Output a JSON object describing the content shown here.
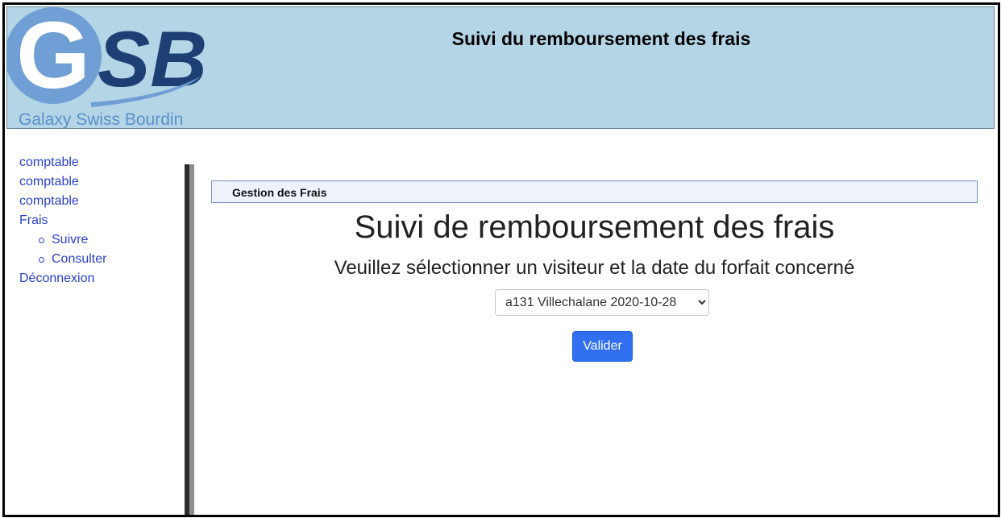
{
  "header": {
    "title": "Suivi du remboursement des frais",
    "logo": {
      "letters_g": "G",
      "letters_sb": "SB",
      "tagline": "Galaxy Swiss Bourdin",
      "colors": {
        "light": "#6f9fd4",
        "dark": "#1e3f74"
      }
    }
  },
  "menu": {
    "items": [
      {
        "label": "comptable"
      },
      {
        "label": "comptable"
      },
      {
        "label": "comptable"
      },
      {
        "label": "Frais",
        "subitems": [
          {
            "label": "Suivre"
          },
          {
            "label": "Consulter"
          }
        ]
      },
      {
        "label": "Déconnexion"
      }
    ]
  },
  "section": {
    "label": "Gestion des Frais"
  },
  "main": {
    "title": "Suivi de remboursement des frais",
    "subtitle": "Veuillez sélectionner un visiteur et la date du forfait concerné",
    "select": {
      "selected": "a131 Villechalane 2020-10-28"
    },
    "submit_label": "Valider"
  },
  "colors": {
    "header_bg": "#b4d5e6",
    "link": "#2a3fd0",
    "button": "#2f6ff0"
  }
}
